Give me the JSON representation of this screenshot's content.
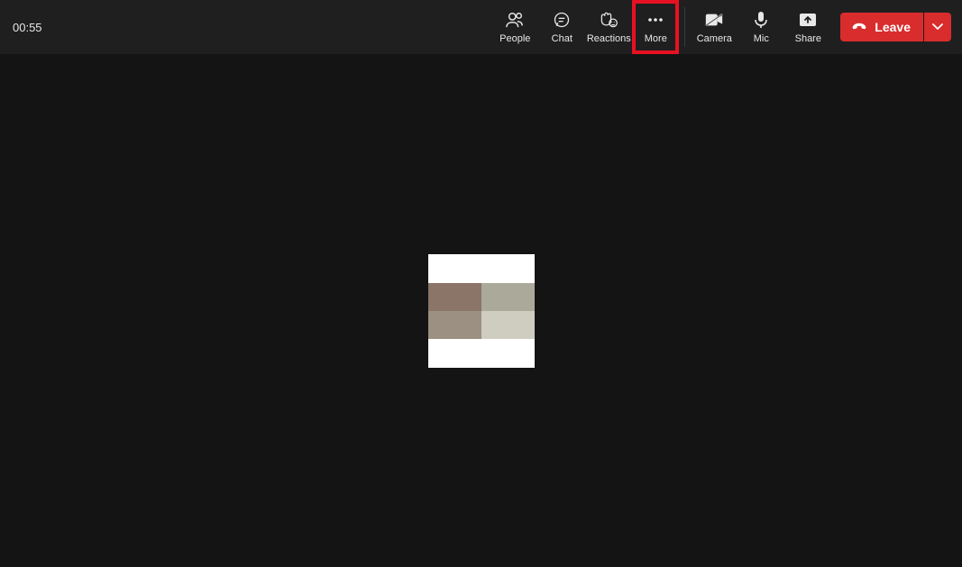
{
  "timer": "00:55",
  "controls": {
    "people": {
      "label": "People"
    },
    "chat": {
      "label": "Chat"
    },
    "reactions": {
      "label": "Reactions"
    },
    "more": {
      "label": "More"
    },
    "camera": {
      "label": "Camera"
    },
    "mic": {
      "label": "Mic"
    },
    "share": {
      "label": "Share"
    }
  },
  "leave": {
    "label": "Leave"
  },
  "highlight": "more",
  "colors": {
    "toolbar_bg": "#201f1f",
    "stage_bg": "#141414",
    "leave_bg": "#d92c2c",
    "highlight_border": "#e81123"
  }
}
